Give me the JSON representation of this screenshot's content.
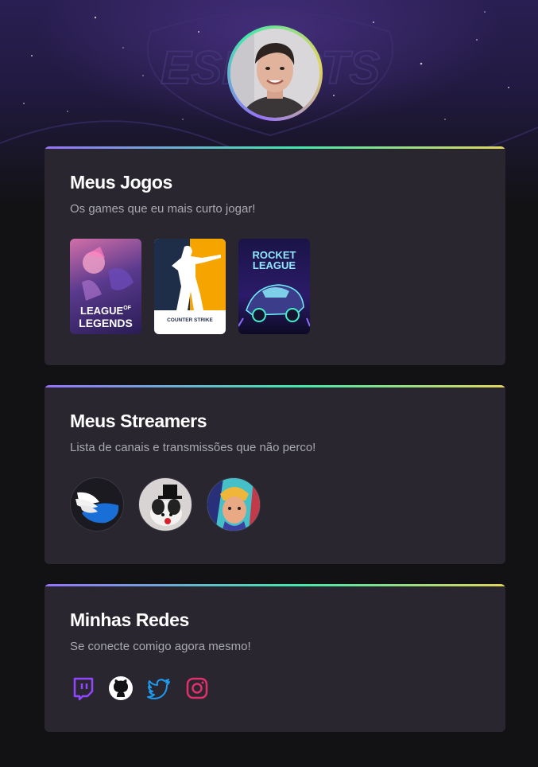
{
  "profile": {
    "avatar_icon": "profile-photo"
  },
  "sections": {
    "games": {
      "title": "Meus Jogos",
      "subtitle": "Os games que eu mais curto jogar!",
      "items": [
        {
          "name": "League of Legends",
          "line1": "LEAGUE",
          "of": "OF",
          "line2": "LEGENDS"
        },
        {
          "name": "Counter-Strike",
          "line1": "COUNTER",
          "line2": "STRIKE"
        },
        {
          "name": "Rocket League",
          "line1": "ROCKET",
          "line2": "LEAGUE"
        }
      ]
    },
    "streamers": {
      "title": "Meus Streamers",
      "subtitle": "Lista de canais e transmissões que não perco!",
      "items": [
        {
          "icon": "winged-hat-avatar"
        },
        {
          "icon": "top-hat-dog-avatar"
        },
        {
          "icon": "cartoon-hero-avatar"
        }
      ]
    },
    "networks": {
      "title": "Minhas Redes",
      "subtitle": "Se conecte comigo agora mesmo!",
      "items": [
        {
          "icon": "twitch-icon",
          "color": "#9146ff"
        },
        {
          "icon": "github-icon",
          "color": "#ffffff"
        },
        {
          "icon": "twitter-icon",
          "color": "#1d9bf0"
        },
        {
          "icon": "instagram-icon",
          "color": "#e1306c"
        }
      ]
    }
  },
  "theme": {
    "background": "#121214",
    "card": "#29262f",
    "gradient": [
      "#9572fc",
      "#43e7ad",
      "#e1d55d"
    ]
  }
}
